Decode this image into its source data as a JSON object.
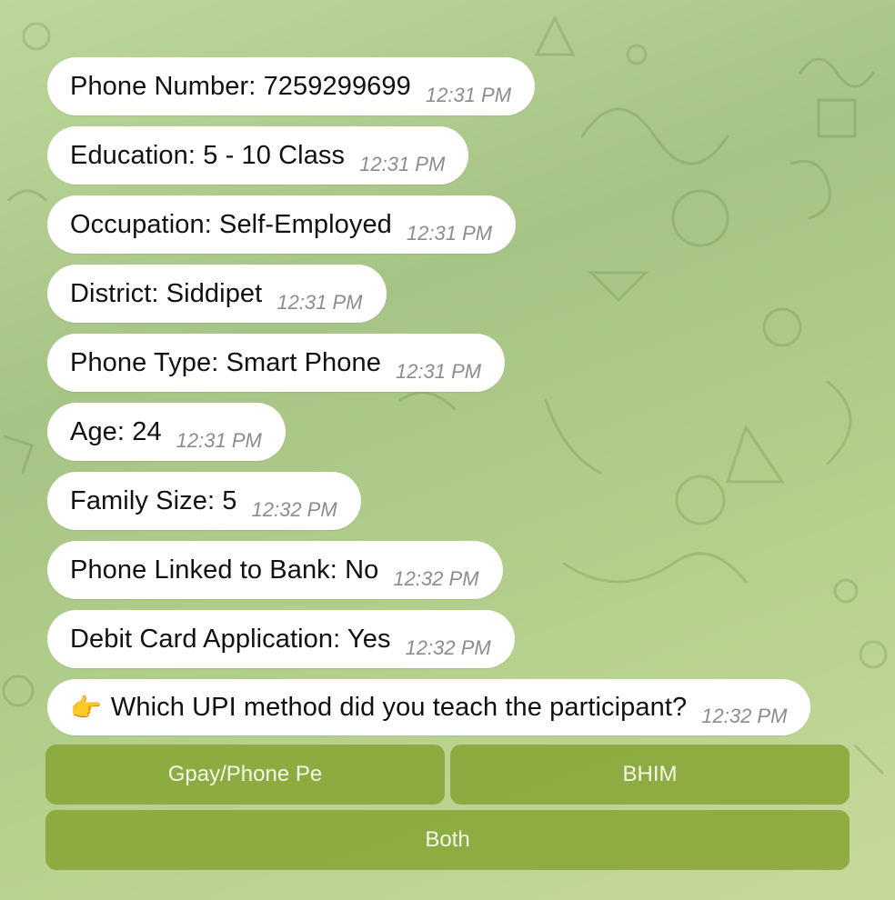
{
  "theme": {
    "bubble_bg": "#ffffff",
    "button_bg": "#8aa33a",
    "background": "#b0cc8c"
  },
  "messages": [
    {
      "text": "Phone Number: 7259299699",
      "time": "12:31 PM"
    },
    {
      "text": "Education: 5 - 10 Class",
      "time": "12:31 PM"
    },
    {
      "text": "Occupation: Self-Employed",
      "time": "12:31 PM"
    },
    {
      "text": "District: Siddipet",
      "time": "12:31 PM"
    },
    {
      "text": "Phone Type: Smart Phone",
      "time": "12:31 PM"
    },
    {
      "text": "Age: 24",
      "time": "12:31 PM"
    },
    {
      "text": "Family Size: 5",
      "time": "12:32 PM"
    },
    {
      "text": "Phone Linked to Bank: No",
      "time": "12:32 PM"
    },
    {
      "text": "Debit Card Application: Yes",
      "time": "12:32 PM"
    },
    {
      "emoji": "👉",
      "text": "Which UPI method did you teach the participant?",
      "time": "12:32 PM"
    }
  ],
  "keyboard": {
    "buttons": [
      {
        "label": "Gpay/Phone Pe"
      },
      {
        "label": "BHIM"
      },
      {
        "label": "Both"
      }
    ]
  }
}
